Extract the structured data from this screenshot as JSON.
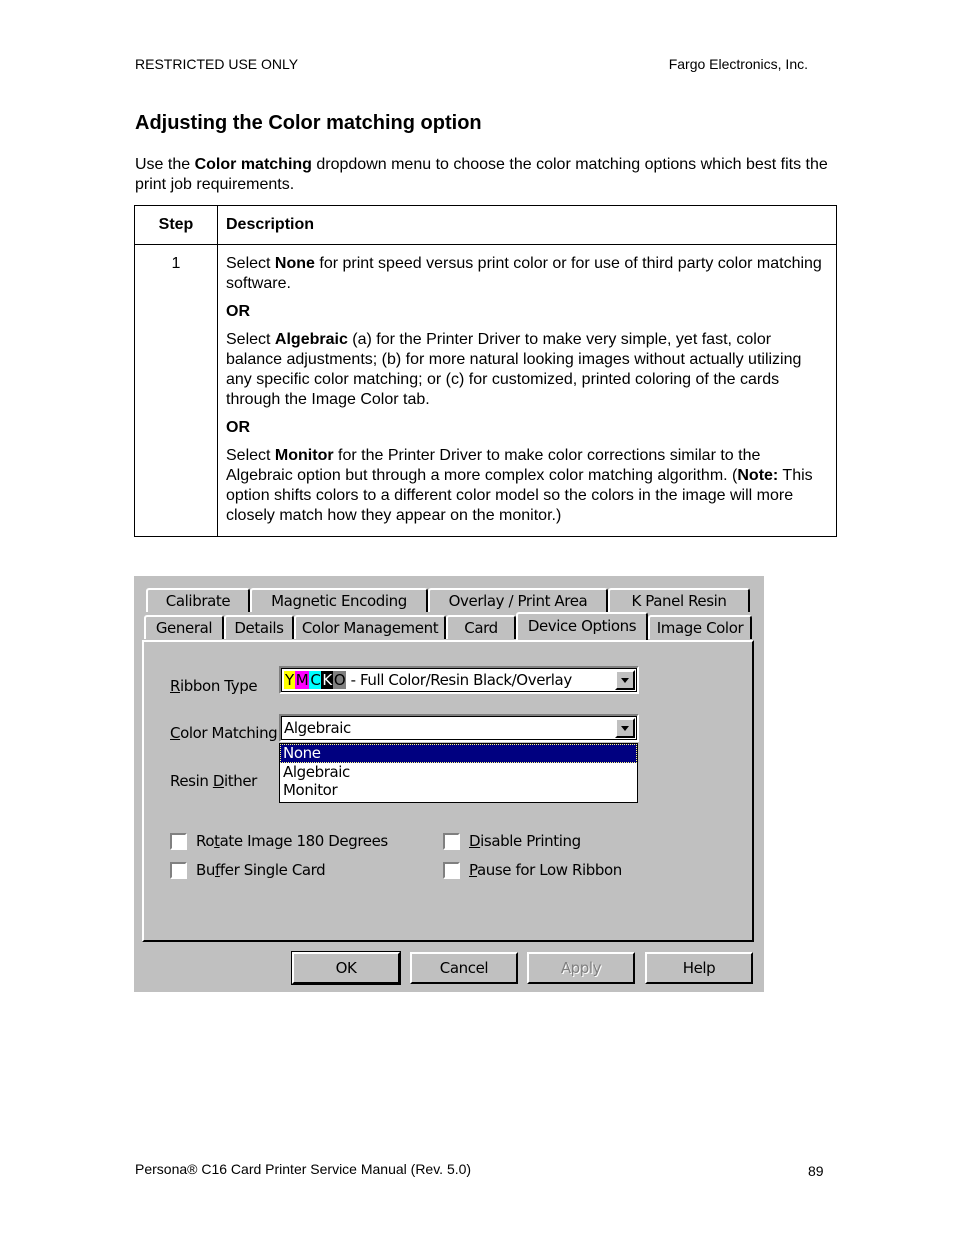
{
  "header": {
    "left": "RESTRICTED USE ONLY",
    "right": "Fargo Electronics, Inc."
  },
  "section": {
    "title": "Adjusting the Color matching option",
    "intro_pre": "Use the ",
    "intro_bold": "Color matching",
    "intro_post": " dropdown menu to choose the color matching options which best fits the print job requirements."
  },
  "table": {
    "headers": [
      "Step",
      "Description"
    ],
    "rows": [
      {
        "step": "1",
        "p1_pre": "Select ",
        "p1_bold": "None",
        "p1_post": " for print speed versus print color or for use of third party color matching software.",
        "or1": "OR",
        "p2_pre": "Select ",
        "p2_bold": "Algebraic",
        "p2_post": " (a) for the Printer Driver to make very simple, yet fast, color balance adjustments; (b) for more natural looking images without actually utilizing any specific color matching; or (c) for customized, printed coloring of the cards through the Image Color tab.",
        "or2": "OR",
        "p3_pre": "Select ",
        "p3_bold": "Monitor",
        "p3_mid": " for the Printer Driver to make color corrections similar to the Algebraic option but through a more complex color matching algorithm. (",
        "p3_note": "Note:",
        "p3_post": " This option shifts colors to a different color model so the colors in the image will more closely match how they appear on the monitor.)"
      }
    ]
  },
  "dialog": {
    "tabs_back": [
      "Calibrate",
      "Magnetic Encoding",
      "Overlay / Print Area",
      "K Panel Resin"
    ],
    "tabs_front": [
      "General",
      "Details",
      "Color Management",
      "Card",
      "Device Options",
      "Image Color"
    ],
    "active_tab": "Device Options",
    "ribbon_type": {
      "label_u": "R",
      "label_rest": "ibbon Type",
      "swatches": [
        {
          "letter": "Y",
          "bg": "#ffff00",
          "fg": "#000000"
        },
        {
          "letter": "M",
          "bg": "#ff00ff",
          "fg": "#000000"
        },
        {
          "letter": "C",
          "bg": "#00ffff",
          "fg": "#000000"
        },
        {
          "letter": "K",
          "bg": "#000000",
          "fg": "#ffffff"
        },
        {
          "letter": "O",
          "bg": "#808080",
          "fg": "#000000"
        }
      ],
      "value": " - Full Color/Resin Black/Overlay"
    },
    "color_matching": {
      "label_u": "C",
      "label_rest": "olor Matching",
      "value": "Algebraic",
      "options": [
        "None",
        "Algebraic",
        "Monitor"
      ],
      "highlighted": "None"
    },
    "resin_dither": {
      "label_pre": "Resin ",
      "label_u": "D",
      "label_rest": "ither"
    },
    "checkboxes": [
      {
        "pre": "Ro",
        "u": "t",
        "post": "ate Image 180 Degrees",
        "checked": false
      },
      {
        "pre": "Bu",
        "u": "f",
        "post": "fer Single Card",
        "checked": false
      },
      {
        "pre": "",
        "u": "D",
        "post": "isable Printing",
        "checked": false
      },
      {
        "pre": "",
        "u": "P",
        "post": "ause for Low Ribbon",
        "checked": false
      }
    ],
    "buttons": {
      "ok": "OK",
      "cancel": "Cancel",
      "apply": "Apply",
      "help": "Help"
    }
  },
  "footer": {
    "left": "Persona® C16 Card Printer Service Manual (Rev. 5.0)",
    "page": "89"
  }
}
